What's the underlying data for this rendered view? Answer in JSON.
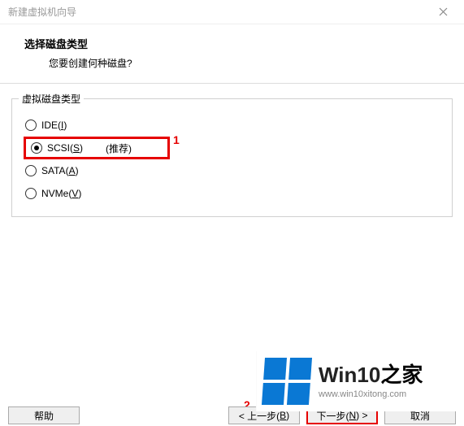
{
  "window": {
    "title": "新建虚拟机向导"
  },
  "header": {
    "title": "选择磁盘类型",
    "subtitle": "您要创建何种磁盘?"
  },
  "group": {
    "legend": "虚拟磁盘类型",
    "options": [
      {
        "label": "IDE",
        "mnemonic": "I",
        "selected": false,
        "extra": ""
      },
      {
        "label": "SCSI",
        "mnemonic": "S",
        "selected": true,
        "extra": "(推荐)"
      },
      {
        "label": "SATA",
        "mnemonic": "A",
        "selected": false,
        "extra": ""
      },
      {
        "label": "NVMe",
        "mnemonic": "V",
        "selected": false,
        "extra": ""
      }
    ]
  },
  "annotations": {
    "a1": "1",
    "a2": "2"
  },
  "buttons": {
    "help": "帮助",
    "back_prefix": "< 上一步(",
    "back_mn": "B",
    "back_suffix": ")",
    "next_prefix": "下一步(",
    "next_mn": "N",
    "next_suffix": ") >",
    "cancel": "取消"
  },
  "watermark": {
    "brand_prefix": "Win10",
    "brand_suffix": "之家",
    "url": "www.win10xitong.com"
  }
}
